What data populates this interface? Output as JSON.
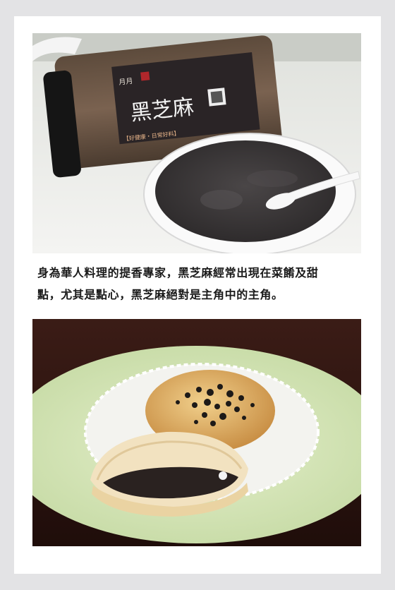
{
  "caption": {
    "line1": "身為華人料理的提香專家，黑芝麻經常出現在菜餚及甜",
    "line2": "點，尤其是點心，黑芝麻絕對是主角中的主角。"
  },
  "jar_label": {
    "title": "黑芝麻",
    "brand": "月月",
    "subtitle": "【好健康・日常好料】"
  },
  "colors": {
    "page_bg": "#e3e3e5",
    "card_bg": "#ffffff",
    "sesame_paste": "#3a3637",
    "plate_green": "#d6e8b8",
    "table_dark": "#2b1410"
  }
}
